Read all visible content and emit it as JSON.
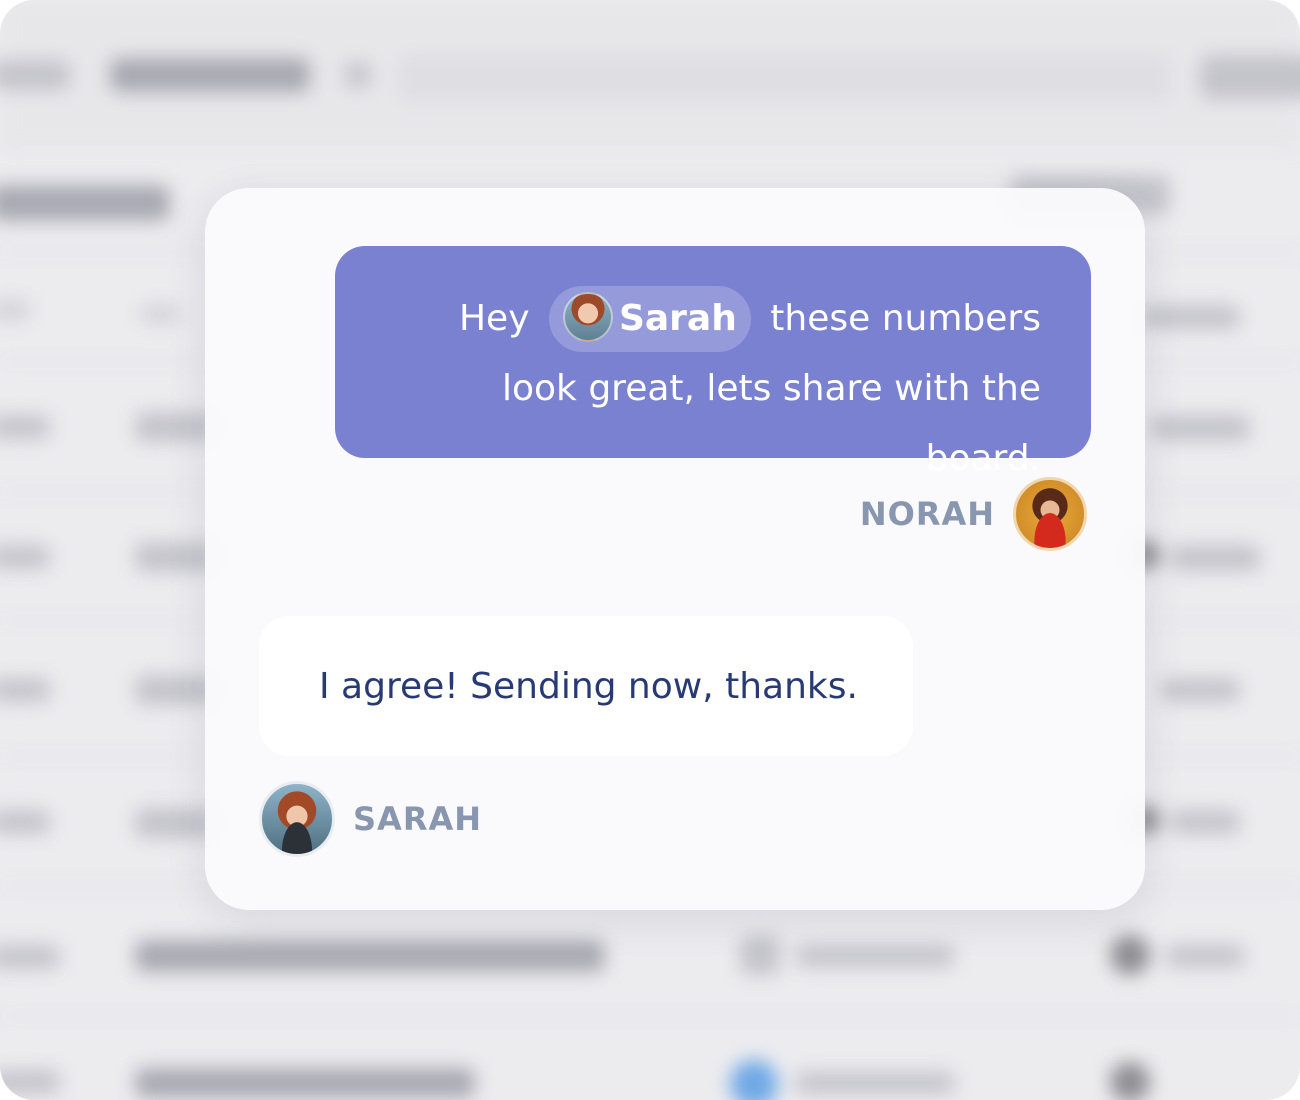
{
  "outgoing_message": {
    "text_before": "Hey",
    "mention_name": "Sarah",
    "text_after": "these numbers look great, lets share with the board.",
    "bubble_color": "#7a81d1"
  },
  "outgoing_author": {
    "name": "NORAH",
    "avatar_icon": "norah-avatar"
  },
  "incoming_message": {
    "text": "I agree! Sending now, thanks."
  },
  "incoming_author": {
    "name": "SARAH",
    "avatar_icon": "sarah-avatar"
  },
  "colors": {
    "author_label": "#8896b0",
    "incoming_text": "#283a75",
    "card_background": "#fafafc"
  }
}
